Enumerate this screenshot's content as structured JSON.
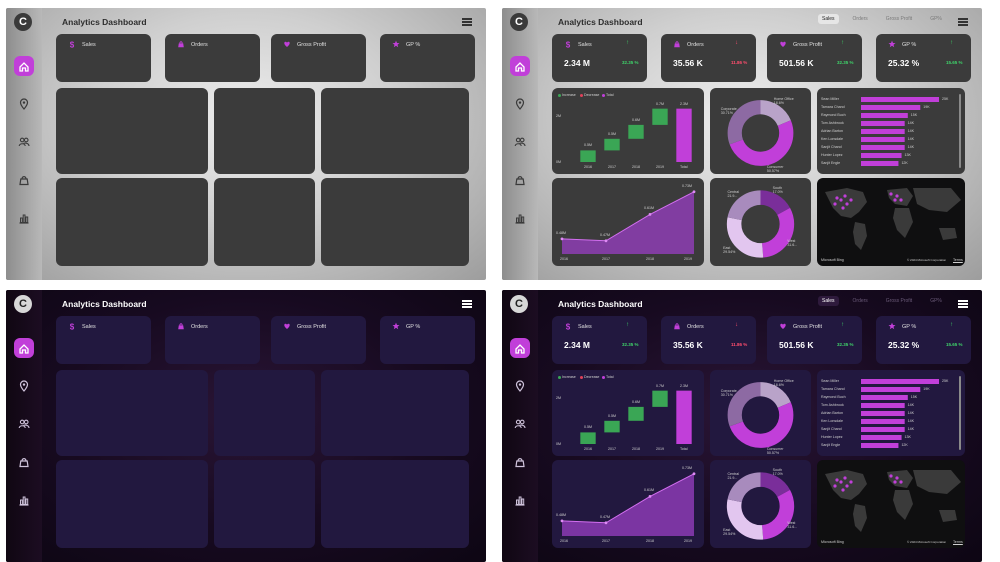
{
  "app": {
    "logo_letter": "C",
    "title": "Analytics Dashboard"
  },
  "nav_icons": [
    "home-icon",
    "location-pin-icon",
    "users-icon",
    "shopping-bag-icon",
    "bar-chart-icon"
  ],
  "tabs": [
    "Sales",
    "Orders",
    "Gross Profit",
    "GP%"
  ],
  "kpis": [
    {
      "name": "Sales",
      "value": "2.34 M",
      "change": "32.35 %",
      "trend": "up",
      "icon": "dollar-icon"
    },
    {
      "name": "Orders",
      "value": "35.56 K",
      "change": "11.86 %",
      "trend": "down",
      "icon": "shopping-bag-icon"
    },
    {
      "name": "Gross Profit",
      "value": "501.56 K",
      "change": "32.35 %",
      "trend": "up",
      "icon": "heart-icon"
    },
    {
      "name": "GP %",
      "value": "25.32 %",
      "change": "15.65 %",
      "trend": "up",
      "icon": "star-icon"
    }
  ],
  "colors": {
    "accent": "#c13fd9",
    "increase": "#3aa655",
    "decrease": "#e0415a",
    "light_card": "#3b3b3b",
    "dark_card": "#22183f"
  },
  "chart_data": [
    {
      "type": "bar",
      "subtype": "waterfall",
      "legend": [
        "Increase",
        "Decrease",
        "Total"
      ],
      "categories": [
        "2016",
        "2017",
        "2018",
        "2019",
        "Total"
      ],
      "values": [
        0.5,
        0.5,
        0.6,
        0.7,
        2.3
      ],
      "data_labels": [
        "0.5M",
        "0.5M",
        "0.6M",
        "0.7M",
        "2.3M"
      ],
      "y_ticks": [
        "2M",
        "0M"
      ],
      "ylim": [
        0,
        2.5
      ]
    },
    {
      "type": "pie",
      "subtype": "donut",
      "slices": [
        {
          "label": "Home Office",
          "value": 18.6,
          "text": "18.6%"
        },
        {
          "label": "Consumer",
          "value": 50.57,
          "text": "50.57%"
        },
        {
          "label": "Corporate",
          "value": 30.71,
          "text": "30.71%"
        }
      ]
    },
    {
      "type": "bar",
      "orientation": "horizontal",
      "categories": [
        "Sean Miller",
        "Tamara Chand",
        "Raymond Buch",
        "Tom Ashbrook",
        "Adrian Barton",
        "Ken Lonsdale",
        "Sanjit Chand",
        "Hunter Lopez",
        "Sanjit Engle"
      ],
      "values": [
        25,
        19,
        15,
        14,
        14,
        14,
        14,
        13,
        12
      ],
      "data_labels": [
        "25K",
        "19K",
        "15K",
        "14K",
        "14K",
        "14K",
        "14K",
        "13K",
        "12K"
      ]
    },
    {
      "type": "area",
      "x": [
        "2016",
        "2017",
        "2018",
        "2019"
      ],
      "values": [
        0.48,
        0.47,
        0.61,
        0.73
      ],
      "data_labels": [
        "0.48M",
        "0.47M",
        "0.61M",
        "0.73M"
      ]
    },
    {
      "type": "pie",
      "subtype": "donut",
      "slices": [
        {
          "label": "South",
          "value": 17.0,
          "text": "17.0%"
        },
        {
          "label": "West",
          "value": 31.6,
          "text": "31.6..."
        },
        {
          "label": "East",
          "value": 29.5,
          "text": "29.54%"
        },
        {
          "label": "Central",
          "value": 21.9,
          "text": "21.9..."
        }
      ]
    }
  ],
  "map": {
    "attribution": "© 2024 Microsoft Corporation",
    "terms": "Terms",
    "provider": "Microsoft Bing"
  }
}
